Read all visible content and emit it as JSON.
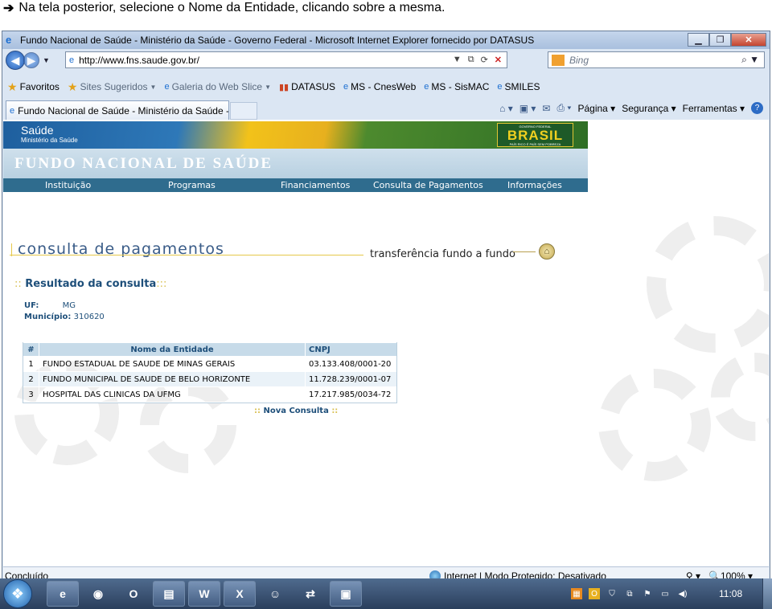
{
  "instruction": {
    "arrow": "➔",
    "text": "Na tela posterior, selecione o Nome da Entidade, clicando sobre a mesma."
  },
  "window": {
    "title": "Fundo Nacional de Saúde - Ministério da Saúde - Governo Federal - Microsoft Internet Explorer fornecido por DATASUS",
    "url": "http://www.fns.saude.gov.br/",
    "search_placeholder": "Bing"
  },
  "favorites": {
    "label": "Favoritos",
    "items": [
      "Sites Sugeridos",
      "Galeria do Web Slice",
      "DATASUS",
      "MS - CnesWeb",
      "MS - SisMAC",
      "SMILES"
    ]
  },
  "tab": {
    "label": "Fundo Nacional de Saúde - Ministério da Saúde -..."
  },
  "commands": {
    "pagina": "Página",
    "seguranca": "Segurança",
    "ferramentas": "Ferramentas"
  },
  "site": {
    "saude": "Saúde",
    "ministerio": "Ministério da Saúde",
    "brasil": "BRASIL",
    "brasil_top": "GOVERNO FEDERAL",
    "brasil_bottom": "PAÍS RICO É PAÍS SEM POBREZA",
    "fns_title": "FUNDO NACIONAL DE SAÚDE",
    "menu": [
      "Instituição",
      "Programas",
      "Financiamentos",
      "Consulta de Pagamentos",
      "Informações"
    ]
  },
  "page": {
    "title": "consulta de pagamentos",
    "subtitle": "transferência fundo a fundo",
    "result_prefix": "::",
    "result_title": "Resultado da consulta",
    "result_suffix": ":::",
    "uf_label": "UF:",
    "uf_value": "MG",
    "municipio_label": "Município:",
    "municipio_value": "310620",
    "table": {
      "headers": [
        "#",
        "Nome da Entidade",
        "CNPJ"
      ],
      "rows": [
        {
          "num": "1",
          "name": "FUNDO ESTADUAL DE SAUDE DE MINAS GERAIS",
          "cnpj": "03.133.408/0001-20"
        },
        {
          "num": "2",
          "name": "FUNDO MUNICIPAL DE SAUDE DE BELO HORIZONTE",
          "cnpj": "11.728.239/0001-07"
        },
        {
          "num": "3",
          "name": "HOSPITAL DAS CLINICAS DA UFMG",
          "cnpj": "17.217.985/0034-72"
        }
      ]
    },
    "nova_consulta": "Nova Consulta",
    "nova_dots": "::"
  },
  "status": {
    "left": "Concluído",
    "zone": "Internet | Modo Protegido: Desativado",
    "zoom": "100%"
  },
  "taskbar": {
    "clock": "11:08"
  }
}
